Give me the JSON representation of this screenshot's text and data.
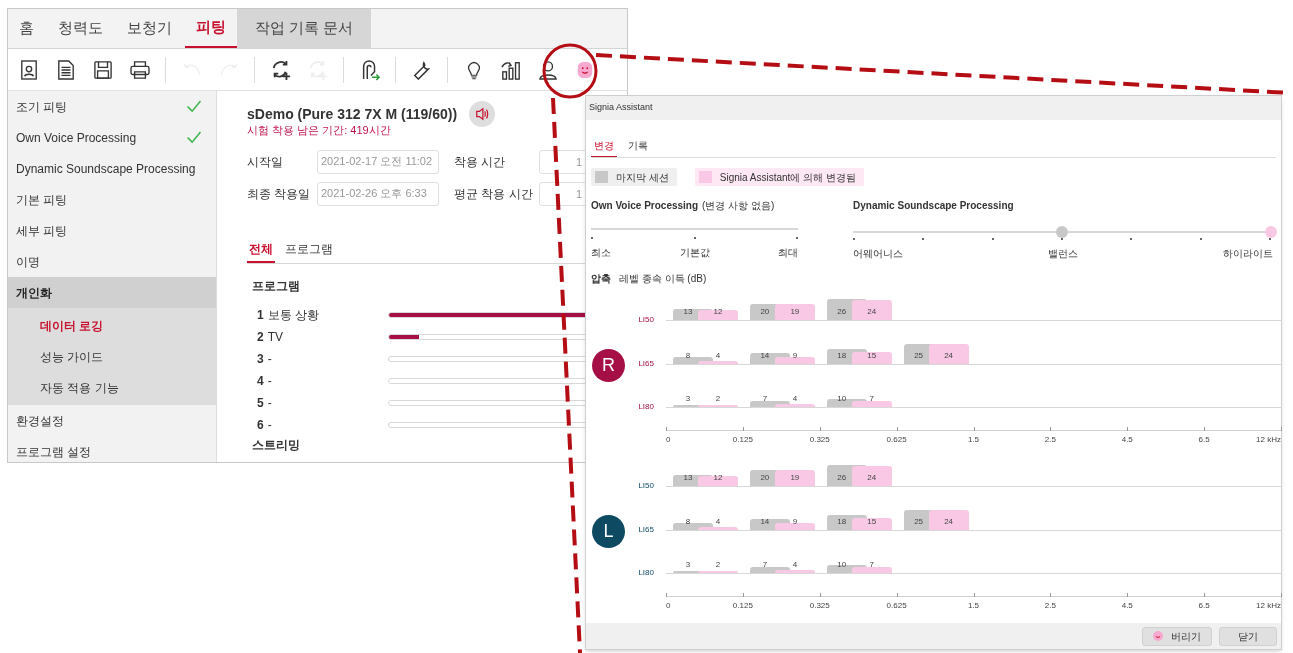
{
  "main_window": {
    "tabs": [
      {
        "label": "홈",
        "selected": false,
        "kind": "plain"
      },
      {
        "label": "청력도",
        "selected": false,
        "kind": "plain"
      },
      {
        "label": "보청기",
        "selected": false,
        "kind": "plain"
      },
      {
        "label": "피팅",
        "selected": true,
        "kind": "plain"
      },
      {
        "label": "작업 기록 문서",
        "selected": false,
        "kind": "shaded"
      }
    ],
    "toolbar": [
      {
        "kind": "patient",
        "disabled": false
      },
      {
        "kind": "document",
        "disabled": false
      },
      {
        "kind": "save",
        "disabled": false
      },
      {
        "kind": "print",
        "disabled": false
      },
      {
        "kind": "separator"
      },
      {
        "kind": "undo",
        "disabled": true
      },
      {
        "kind": "redo",
        "disabled": true
      },
      {
        "kind": "separator"
      },
      {
        "kind": "sync",
        "disabled": false
      },
      {
        "kind": "sync",
        "disabled": true
      },
      {
        "kind": "separator"
      },
      {
        "kind": "device",
        "disabled": false
      },
      {
        "kind": "separator"
      },
      {
        "kind": "wrench",
        "disabled": false
      },
      {
        "kind": "separator"
      },
      {
        "kind": "bulb",
        "disabled": false
      },
      {
        "kind": "levels",
        "disabled": false
      },
      {
        "kind": "person",
        "disabled": false
      },
      {
        "kind": "face",
        "disabled": false
      }
    ],
    "sidebar": [
      {
        "label": "조기 피팅",
        "checked": true,
        "selected": false
      },
      {
        "label": "Own Voice Processing",
        "checked": true,
        "selected": false
      },
      {
        "label": "Dynamic Soundscape Processing",
        "checked": false,
        "selected": false
      },
      {
        "label": "기본 피팅",
        "checked": false,
        "selected": false
      },
      {
        "label": "세부 피팅",
        "checked": false,
        "selected": false
      },
      {
        "label": "이명",
        "checked": false,
        "selected": false
      },
      {
        "label": "개인화",
        "checked": false,
        "selected": false,
        "expanded": true,
        "children": [
          {
            "label": "데이터 로깅",
            "selected": true
          },
          {
            "label": "성능 가이드",
            "selected": false
          },
          {
            "label": "자동 적용 기능",
            "selected": false
          }
        ]
      },
      {
        "label": "환경설정",
        "checked": false,
        "selected": false
      },
      {
        "label": "프로그램 설정",
        "checked": false,
        "selected": false
      }
    ],
    "device": {
      "title": "sDemo (Pure 312 7X M (119/60))",
      "trial": "시험 착용 남은 기간: 419시간"
    },
    "fields": [
      {
        "label": "시작일",
        "value": "2021-02-17 오전 11:02"
      },
      {
        "label": "착용 시간",
        "value": "1"
      },
      {
        "label": "최종 착용일",
        "value": "2021-02-26 오후 6:33"
      },
      {
        "label": "평균 착용 시간",
        "value": "1"
      }
    ],
    "subtabs": [
      {
        "label": "전체",
        "selected": true
      },
      {
        "label": "프로그램",
        "selected": false
      }
    ],
    "section_title": "프로그램",
    "programs": [
      {
        "number": "1",
        "name": "보통 상황",
        "level": 1
      },
      {
        "number": "2",
        "name": "TV",
        "level": 0.1
      },
      {
        "number": "3",
        "name": "-",
        "level": 0
      },
      {
        "number": "4",
        "name": "-",
        "level": 0
      },
      {
        "number": "5",
        "name": "-",
        "level": 0
      },
      {
        "number": "6",
        "name": "-",
        "level": 0
      }
    ],
    "next_section": "스트리밍"
  },
  "assistant": {
    "title": "Signia Assistant",
    "tabs": [
      {
        "label": "변경",
        "selected": true
      },
      {
        "label": "기록",
        "selected": false
      }
    ],
    "legend": [
      {
        "label": "마지막 세션",
        "color": "#c8c8c8"
      },
      {
        "label": "Signia Assistant에 의해 변경됨",
        "color": "#f9c8e4"
      }
    ],
    "ovp": {
      "title": "Own Voice Processing",
      "note": "(변경 사항 없음)",
      "labels": [
        "최소",
        "기본값",
        "최대"
      ]
    },
    "dsp": {
      "title": "Dynamic Soundscape Processing",
      "labels": [
        "어웨어니스",
        "밸런스",
        "하이라이트"
      ],
      "markers": [
        {
          "kind": "last",
          "level": 0.5
        },
        {
          "kind": "assistant",
          "level": 1
        }
      ]
    },
    "compression": {
      "title": "압축",
      "subtitle": "레벨 종속 이득 (dB)"
    },
    "ears": [
      {
        "side": "R",
        "color": "#a50f46",
        "rows": [
          {
            "label": "LI50",
            "bars": [
              [
                "13",
                "12"
              ],
              [
                "20",
                "19"
              ],
              [
                "26",
                "24"
              ]
            ]
          },
          {
            "label": "LI65",
            "bars": [
              [
                "8",
                "4"
              ],
              [
                "14",
                "9"
              ],
              [
                "18",
                "15"
              ],
              [
                "25",
                "24"
              ]
            ]
          },
          {
            "label": "LI80",
            "bars": [
              [
                "3",
                "2"
              ],
              [
                "7",
                "4"
              ],
              [
                "10",
                "7"
              ]
            ]
          }
        ],
        "axis": [
          "0",
          "0.125",
          "0.325",
          "0.625",
          "1.5",
          "2.5",
          "4.5",
          "6.5",
          "12 kHz"
        ]
      },
      {
        "side": "L",
        "color": "#0f4a63",
        "rows": [
          {
            "label": "LI50",
            "bars": [
              [
                "13",
                "12"
              ],
              [
                "20",
                "19"
              ],
              [
                "26",
                "24"
              ]
            ]
          },
          {
            "label": "LI65",
            "bars": [
              [
                "8",
                "4"
              ],
              [
                "14",
                "9"
              ],
              [
                "18",
                "15"
              ],
              [
                "25",
                "24"
              ]
            ]
          },
          {
            "label": "LI80",
            "bars": [
              [
                "3",
                "2"
              ],
              [
                "7",
                "4"
              ],
              [
                "10",
                "7"
              ]
            ]
          }
        ],
        "axis": [
          "0",
          "0.125",
          "0.325",
          "0.625",
          "1.5",
          "2.5",
          "4.5",
          "6.5",
          "12 kHz"
        ]
      }
    ],
    "buttons": [
      {
        "label": "버리기",
        "kind": "discard"
      },
      {
        "label": "닫기",
        "kind": "close"
      }
    ]
  }
}
